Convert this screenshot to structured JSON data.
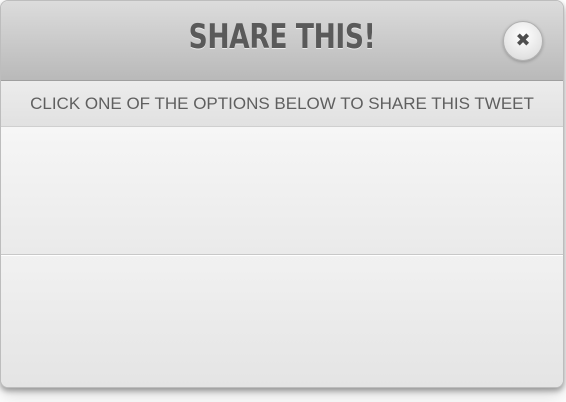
{
  "modal": {
    "title": "SHARE THIS!",
    "close_symbol": "✖",
    "close_icon": "close-icon",
    "instructions": "CLICK ONE OF THE OPTIONS BELOW TO SHARE THIS TWEET"
  },
  "colors": {
    "header_top": "#dcdcdc",
    "header_bottom": "#b9b9b9",
    "title_text": "#5a5a5a",
    "panel_background": "#efefef"
  },
  "options": [
    {
      "label": ""
    },
    {
      "label": ""
    }
  ]
}
